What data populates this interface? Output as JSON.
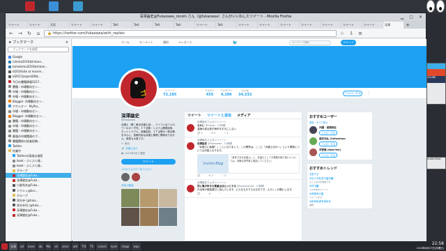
{
  "desktop": {
    "icon_colors": [
      "#c0272d",
      "#3c8fd6",
      "#3b9acf",
      "#e9a23b"
    ]
  },
  "window": {
    "title": "深澤論史@Fukazawa_ronshi さん（@fukazawa）さんがいいねしたツイート - Mozilla Firefox"
  },
  "tabs": [
    "ツイート",
    "ツイート",
    "天気",
    "ツイート",
    "ツイート",
    "Twit",
    "Twit",
    "Twit",
    "Twit",
    "ツイート",
    "Twit",
    "ツイート",
    "ツイート",
    "ツイート",
    "ツイート",
    "ツイート",
    "ツイート",
    "ツイート",
    "深澤"
  ],
  "navbar": {
    "url": "https://twitter.com/fukazawa/with_replies"
  },
  "sidebar": {
    "header": "ブックマーク",
    "close": "×",
    "search_placeholder": "ブックマークを検索",
    "items": [
      {
        "label": "Google",
        "color": "#4285f4"
      },
      {
        "label": "nimmo2016年Intone...",
        "color": "#2a7ab0"
      },
      {
        "label": "tomotomo2016年Intom...",
        "color": "#2a7ab0"
      },
      {
        "label": "ld2016site at maxim...",
        "color": "#555"
      },
      {
        "label": "ld2017joojack08年...",
        "color": "#555"
      },
      {
        "label": "今日の書籍情報2017...",
        "color": "#c0272d"
      },
      {
        "label": "書籍・市場動向セン...",
        "color": "#888"
      },
      {
        "label": "市場・市場動向セン...",
        "color": "#888"
      },
      {
        "label": "市場・市場動向セン...",
        "color": "#888"
      },
      {
        "label": "Blogger: 市場動向セン...",
        "color": "#f57d00"
      },
      {
        "label": "アクシオー：MyPro...",
        "color": "#3c8fd6"
      },
      {
        "label": "市場・市場動向セン...",
        "color": "#888"
      },
      {
        "label": "Blogger: 市場動向セン...",
        "color": "#f57d00"
      },
      {
        "label": "書籍・市場動向セン...",
        "color": "#888"
      },
      {
        "label": "市場・市場動向セン...",
        "color": "#888"
      },
      {
        "label": "書籍・市場動向セン...",
        "color": "#888"
      },
      {
        "label": "最強の市場関連のブ...",
        "color": "#888"
      },
      {
        "label": "書籍関係の読者投稿...",
        "color": "#888"
      },
      {
        "label": "Twitter",
        "color": "#1da1f2"
      },
      {
        "label": "作業中",
        "color": "#e0c050"
      },
      {
        "label": "Twitterの高度な検索",
        "color": "#1da1f2"
      },
      {
        "label": "book・ぶくぶく検...",
        "color": "#888"
      },
      {
        "label": "book・ぶくぶく検...",
        "color": "#888"
      },
      {
        "label": "グループ",
        "color": "#e0c050"
      },
      {
        "label": "深澤論史@Fuka...",
        "color": "#c0272d"
      },
      {
        "label": "深澤論史@Fuka...",
        "color": "#c0272d"
      },
      {
        "label": "小倉秀夫@Fuka...",
        "color": "#555"
      },
      {
        "label": "ミクシィ@bcc...",
        "color": "#555"
      },
      {
        "label": "グループ",
        "color": "#e0c050"
      },
      {
        "label": "栄光寺 (@fuka...",
        "color": "#555"
      },
      {
        "label": "栄光寺司 (@fuka...",
        "color": "#555"
      },
      {
        "label": "深澤論史@Fuka...",
        "color": "#c0272d"
      },
      {
        "label": "深澤論史@Fuka...",
        "color": "#c0272d"
      }
    ],
    "selected_index": 24
  },
  "twitter": {
    "nav": [
      "ホーム",
      "モーメント",
      "通知",
      "メッセージ"
    ],
    "search_placeholder": "キーワード検索",
    "tweet_button": "ツイート",
    "stats": [
      {
        "label": "ツイート",
        "value": "72,185"
      },
      {
        "label": "フォロー",
        "value": "455"
      },
      {
        "label": "フォロワー",
        "value": "4,106"
      },
      {
        "label": "いいね",
        "value": "34,332"
      }
    ],
    "follow_button": "フォローする",
    "more_button": "⋮",
    "profile": {
      "name": "深澤論史",
      "handle": "@fukazawa",
      "bio": "弁護士（第二東京弁護士会）。アイコンはフォロワーのロー子作。ＩＴ法務・システム開発紛争、ネットトラブル、債権回収、ＩＴ企業の一般法務を中心に。投稿内容は弁護士業務と関係ありません。家族も大事です。",
      "location": "東京",
      "website": "弁護士法人",
      "joined": "2012年3月に登録",
      "tweet_button": "ツイート",
      "known_followers": "1人のフォロワーをフォロー",
      "media_label": "写真と動画"
    },
    "timeline": {
      "tabs": [
        "ツイート",
        "ツイートと返信",
        "メディア"
      ],
      "tweets": [
        {
          "context": "深澤論史さんがリツイート",
          "name": "なかに",
          "handle": "@nakaji · 12時間",
          "text": "温暖の夏は夏中毎年を平凡にしない",
          "card": null,
          "actions": [
            "1",
            "2",
            "4"
          ]
        },
        {
          "context": "深澤論史さんがリツイート",
          "name": "深澤論史",
          "handle": "@fukazawa · 12時間",
          "text": "「弁護士に転職？」ことになりまして、この業界は、ここに「弁護士法の〜」という業務については可能となります。",
          "card": {
            "brand": "Invitro Blog",
            "text": "「身体である弁護士」と、弁護士としての業務の取り扱いについては、判断は専門家に相談してください。"
          },
          "actions": [
            "",
            "1",
            "3"
          ]
        },
        {
          "context": "深澤論史さんがリツイート",
          "name": "花に亀が好きな貴重はぼんっとする",
          "handle": "@kameyanda · 12時間",
          "text": "外出時の服装選びに悩んでいます。どんなものでも大丈夫です。よろしくお願いします。",
          "card": null,
          "actions": [
            "",
            "",
            ""
          ]
        }
      ]
    },
    "suggest": {
      "title": "おすすめユーザー",
      "sub": "更新・すべて表示",
      "users": [
        {
          "name": "外國 · 居間商社",
          "btn": "フォローする",
          "color": "#445"
        },
        {
          "name": "森井光弘 @stiwaham",
          "btn": "フォローする",
          "color": "#6a5"
        },
        {
          "name": "平野雅 (fake-fee)",
          "btn": "フォローする",
          "color": "#a55"
        }
      ]
    },
    "trends": {
      "title": "おすすめトレンド",
      "sub": "変更する",
      "items": [
        {
          "tag": "#さくらもち人生の話",
          "desc": "さくらもちが話題です"
        },
        {
          "tag": "#ウマ娘",
          "desc": "1,234件のツイート"
        },
        {
          "tag": "#今日の人生",
          "desc": "ツイートする"
        },
        {
          "tag": "#かがみまやまから",
          "desc": "話題"
        }
      ]
    }
  },
  "right_panel": {
    "labels": [
      "2016年",
      "screenShot"
    ]
  },
  "taskbar": {
    "items": [
      "深澤",
      "ad",
      "anse",
      "ab",
      "Mo",
      "sh",
      "anse",
      "atd",
      "Tilt",
      "Th",
      "xclock",
      "eyes",
      "ctago",
      "wpa"
    ],
    "active_index": 0,
    "clock_time": "22:58",
    "clock_date": "2018年8月27日(月曜日)"
  }
}
